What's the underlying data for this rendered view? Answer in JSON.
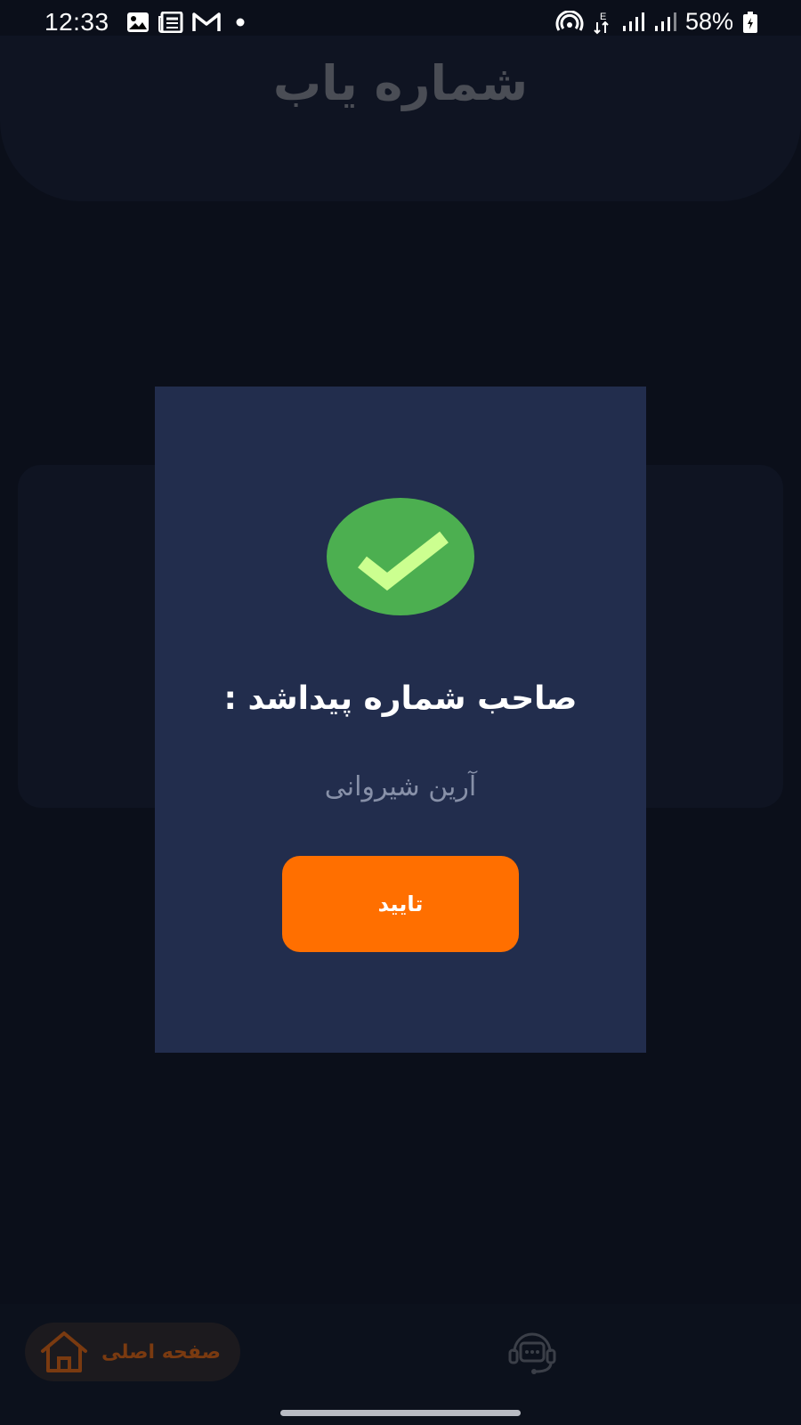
{
  "status_bar": {
    "time": "12:33",
    "battery": "58%",
    "icons_left": [
      "image-icon",
      "news-icon",
      "gmail-icon",
      "dot-icon"
    ],
    "icons_right": [
      "hotspot-icon",
      "data-arrows-icon",
      "signal-icon",
      "signal-icon",
      "battery-icon"
    ]
  },
  "header": {
    "title": "شماره یاب"
  },
  "dialog": {
    "heading": "صاحب شماره پیداشد :",
    "owner_name": "آرین شیروانی",
    "confirm_label": "تایید",
    "accent_color": "#ff6f00",
    "success_color": "#4caf50"
  },
  "bottom_nav": {
    "home_label": "صفحه اصلی",
    "items": [
      "home-icon",
      "support-chat-icon"
    ]
  }
}
